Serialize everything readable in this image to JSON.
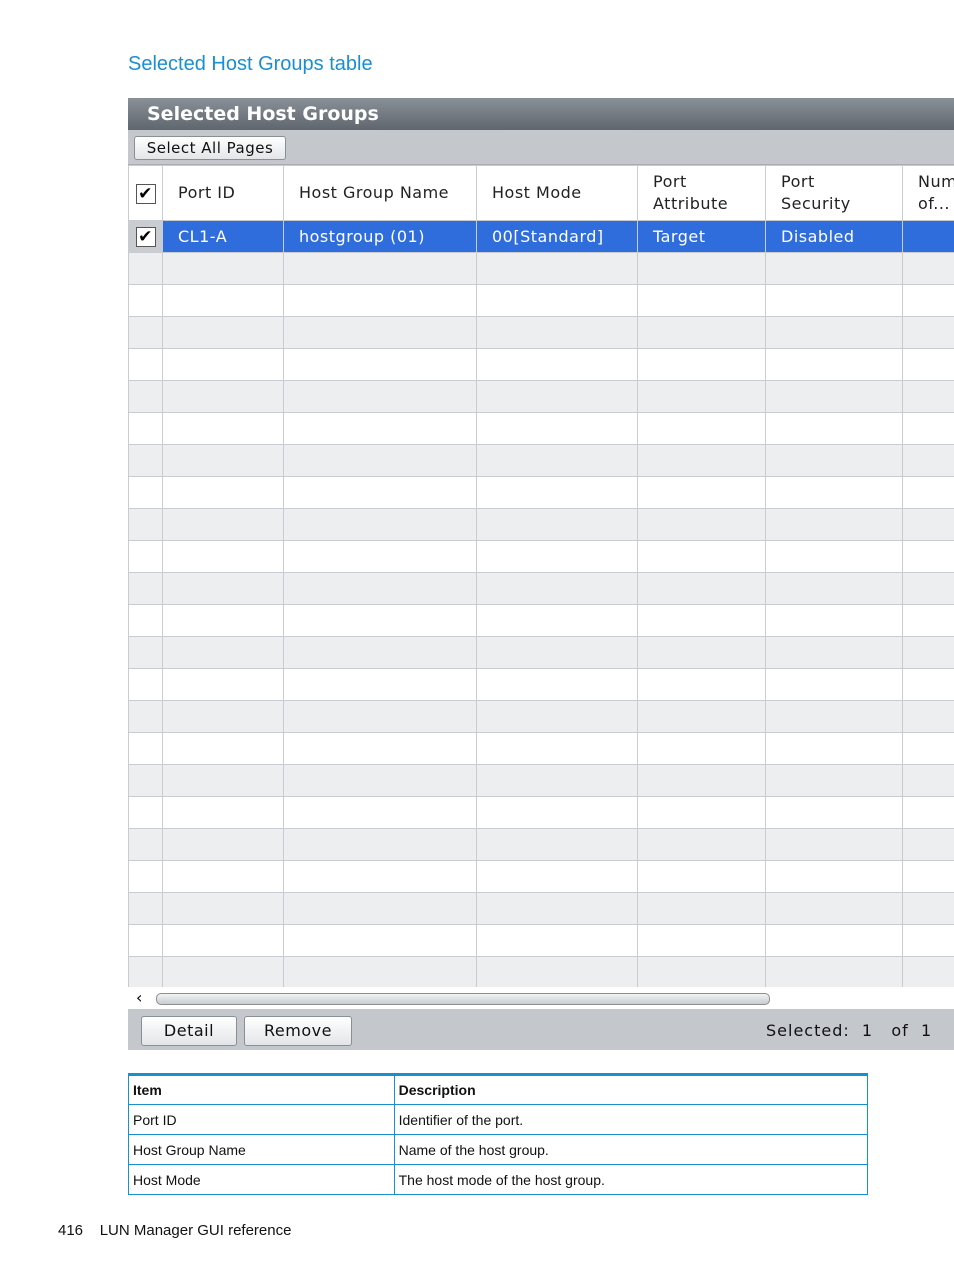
{
  "section_heading": "Selected Host Groups table",
  "panel": {
    "title": "Selected Host Groups",
    "select_all_label": "Select All Pages",
    "columns": [
      "Port ID",
      "Host Group Name",
      "Host Mode",
      "Port\nAttribute",
      "Port\nSecurity",
      "Num\nof..."
    ],
    "rows": [
      {
        "checked": true,
        "selected": true,
        "cells": [
          "CL1-A",
          "hostgroup (01)",
          "00[Standard]",
          "Target",
          "Disabled",
          ""
        ]
      }
    ],
    "empty_row_count": 23,
    "scroll_left_arrow": "‹",
    "detail_label": "Detail",
    "remove_label": "Remove",
    "selected_status": "Selected:  1   of  1",
    "header_checkbox_checked": true,
    "selection_color": "#2f6cdc"
  },
  "description_table": {
    "headers": [
      "Item",
      "Description"
    ],
    "rows": [
      [
        "Port ID",
        "Identifier of the port."
      ],
      [
        "Host Group Name",
        "Name of the host group."
      ],
      [
        "Host Mode",
        "The host mode of the host group."
      ]
    ]
  },
  "footer": {
    "page_number": "416",
    "title": "LUN Manager GUI reference"
  }
}
